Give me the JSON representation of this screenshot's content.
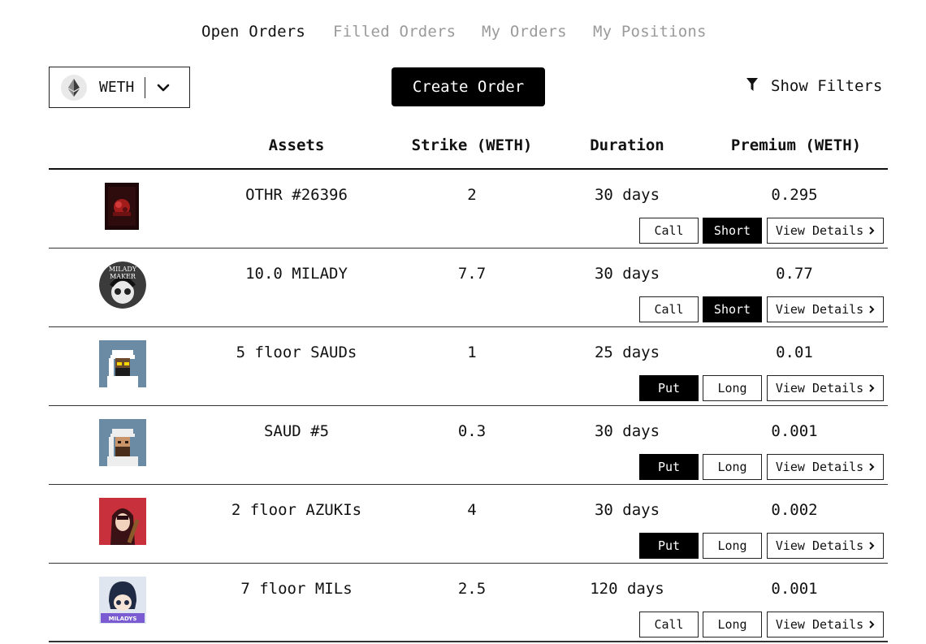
{
  "tabs": [
    "Open Orders",
    "Filled Orders",
    "My Orders",
    "My Positions"
  ],
  "active_tab": 0,
  "asset_selector": {
    "label": "WETH",
    "icon": "ethereum-icon"
  },
  "create_order_label": "Create Order",
  "filters_label": "Show Filters",
  "columns": {
    "assets": "Assets",
    "strike": "Strike (WETH)",
    "duration": "Duration",
    "premium": "Premium (WETH)"
  },
  "view_details_label": "View Details",
  "rows": [
    {
      "asset": "OTHR #26396",
      "strike": "2",
      "duration": "30 days",
      "premium": "0.295",
      "type": "Call",
      "side": "Short",
      "type_active": false,
      "side_active": true
    },
    {
      "asset": "10.0 MILADY",
      "strike": "7.7",
      "duration": "30 days",
      "premium": "0.77",
      "type": "Call",
      "side": "Short",
      "type_active": false,
      "side_active": true
    },
    {
      "asset": "5 floor SAUDs",
      "strike": "1",
      "duration": "25 days",
      "premium": "0.01",
      "type": "Put",
      "side": "Long",
      "type_active": true,
      "side_active": false
    },
    {
      "asset": "SAUD #5",
      "strike": "0.3",
      "duration": "30 days",
      "premium": "0.001",
      "type": "Put",
      "side": "Long",
      "type_active": true,
      "side_active": false
    },
    {
      "asset": "2 floor AZUKIs",
      "strike": "4",
      "duration": "30 days",
      "premium": "0.002",
      "type": "Put",
      "side": "Long",
      "type_active": true,
      "side_active": false
    },
    {
      "asset": "7 floor MILs",
      "strike": "2.5",
      "duration": "120 days",
      "premium": "0.001",
      "type": "Call",
      "side": "Long",
      "type_active": false,
      "side_active": false
    }
  ],
  "thumbnail_logo_text": {
    "milady": "MILADY MAKER",
    "mils": "MILADYS"
  }
}
